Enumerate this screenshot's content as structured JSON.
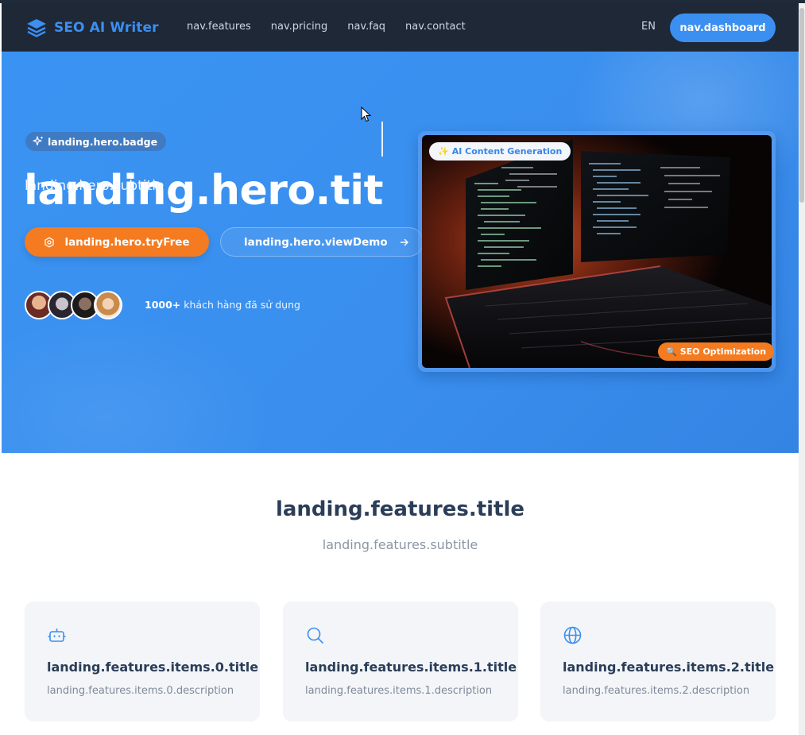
{
  "nav": {
    "logo_text": "SEO AI Writer",
    "links": [
      "nav.features",
      "nav.pricing",
      "nav.faq",
      "nav.contact"
    ],
    "language": "EN",
    "dashboard_button": "nav.dashboard"
  },
  "hero": {
    "badge": "landing.hero.badge",
    "title": "landing.hero.title",
    "subtitle": "landing.hero.subtitle",
    "try_free_button": "landing.hero.tryFree",
    "view_demo_button": "landing.hero.viewDemo",
    "social_proof_count": "1000+",
    "social_proof_text": "khách hàng đã sử dụng",
    "image_pill_ai": "AI Content Generation",
    "image_pill_seo": "SEO Optimization"
  },
  "features": {
    "title": "landing.features.title",
    "subtitle": "landing.features.subtitle",
    "items": [
      {
        "icon": "robot-icon",
        "title": "landing.features.items.0.title",
        "description": "landing.features.items.0.description"
      },
      {
        "icon": "search-icon",
        "title": "landing.features.items.1.title",
        "description": "landing.features.items.1.description"
      },
      {
        "icon": "globe-icon",
        "title": "landing.features.items.2.title",
        "description": "landing.features.items.2.description"
      }
    ]
  },
  "colors": {
    "nav_bg": "#1e2837",
    "accent_blue": "#3b8ff0",
    "accent_orange": "#f47b20",
    "hero_bg": "#3a93f2",
    "heading_dark": "#2b3e58"
  }
}
